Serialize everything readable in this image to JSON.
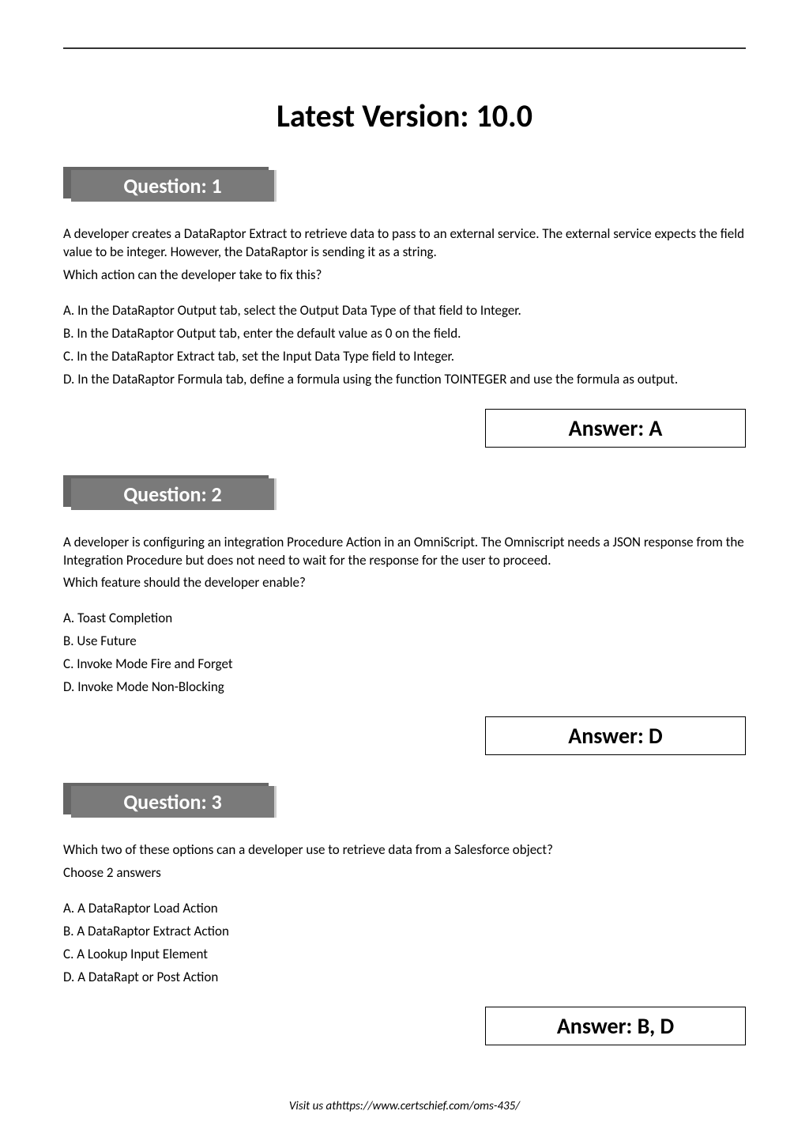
{
  "version_title": "Latest Version: 10.0",
  "questions": [
    {
      "label": "Question: 1",
      "prompt": [
        "A developer creates a DataRaptor Extract to retrieve data to pass to an external service. The external service expects the field value to be integer. However, the DataRaptor is sending it as a string.",
        "Which action can the developer take to fix this?"
      ],
      "options": [
        "A. In the DataRaptor Output tab, select the Output Data Type of that field to Integer.",
        "B. In the DataRaptor Output tab, enter the default value as 0 on the field.",
        "C. In the DataRaptor Extract tab, set the Input Data Type field to Integer.",
        "D. In the DataRaptor Formula tab, define a formula using the function TOINTEGER and use the formula as output."
      ],
      "answer": "Answer: A"
    },
    {
      "label": "Question: 2",
      "prompt": [
        "A developer is configuring an integration Procedure Action in an OmniScript. The Omniscript needs a JSON response from the Integration Procedure but does not need to wait for the response for the user to proceed.",
        "Which feature should the developer enable?"
      ],
      "options": [
        "A. Toast Completion",
        "B. Use Future",
        "C. Invoke Mode Fire and Forget",
        "D. Invoke Mode Non-Blocking"
      ],
      "answer": "Answer: D"
    },
    {
      "label": "Question: 3",
      "prompt": [
        "Which two of these options can a developer use to retrieve data from a Salesforce object?",
        "Choose 2 answers"
      ],
      "options": [
        "A. A DataRaptor Load Action",
        "B. A DataRaptor Extract Action",
        "C. A Lookup Input Element",
        "D. A DataRapt or Post Action"
      ],
      "answer": "Answer: B, D"
    }
  ],
  "footer": "Visit us athttps://www.certschief.com/oms-435/"
}
